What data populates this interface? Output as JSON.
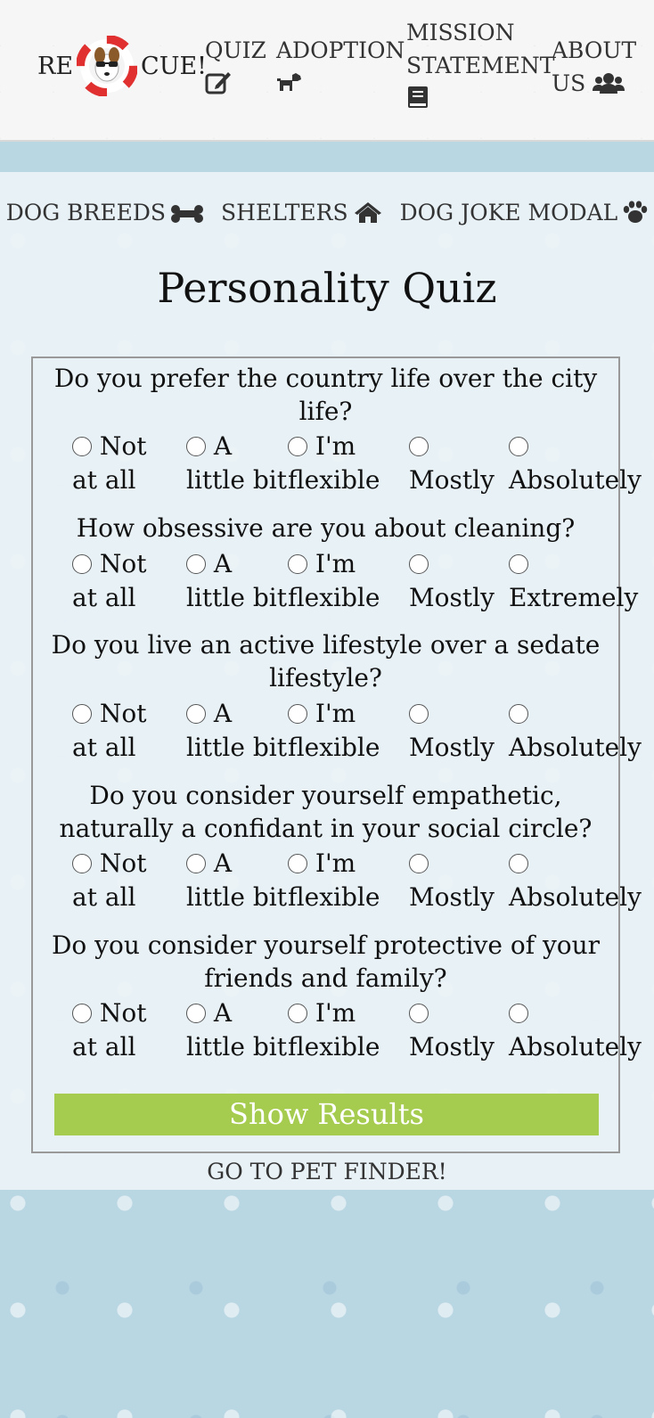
{
  "header": {
    "brand_left": "RE",
    "brand_right": "CUE!",
    "nav": [
      {
        "line1": "QUIZ",
        "icon": "edit-icon"
      },
      {
        "line1": "ADOPTION",
        "icon": "dog-icon"
      },
      {
        "line1": "MISSION",
        "line2": "STATEMENT",
        "icon": "book-icon"
      },
      {
        "line1": "ABOUT",
        "line2": "US",
        "icon": "users-icon"
      }
    ]
  },
  "subnav": [
    {
      "label": "DOG BREEDS",
      "icon": "bone-icon"
    },
    {
      "label": "SHELTERS",
      "icon": "home-icon"
    },
    {
      "label": "DOG JOKE MODAL",
      "icon": "paw-icon"
    }
  ],
  "title": "Personality Quiz",
  "questions": [
    {
      "text": "Do you prefer the country life over the city life?",
      "options": [
        "Not at all",
        "A little bit",
        "I'm flexible",
        "Mostly",
        "Absolutely"
      ]
    },
    {
      "text": "How obsessive are you about cleaning?",
      "options": [
        "Not at all",
        "A little bit",
        "I'm flexible",
        "Mostly",
        "Extremely"
      ]
    },
    {
      "text": "Do you live an active lifestyle over a sedate lifestyle?",
      "options": [
        "Not at all",
        "A little bit",
        "I'm flexible",
        "Mostly",
        "Absolutely"
      ]
    },
    {
      "text": "Do you consider yourself empathetic, naturally a confidant in your social circle?",
      "options": [
        "Not at all",
        "A little bit",
        "I'm flexible",
        "Mostly",
        "Absolutely"
      ]
    },
    {
      "text": "Do you consider yourself protective of your friends and family?",
      "options": [
        "Not at all",
        "A little bit",
        "I'm flexible",
        "Mostly",
        "Absolutely"
      ]
    }
  ],
  "submit_label": "Show Results",
  "petfinder_link": "GO TO PET FINDER!",
  "colors": {
    "button": "#a6cc4f",
    "background": "#b9d6e3"
  }
}
